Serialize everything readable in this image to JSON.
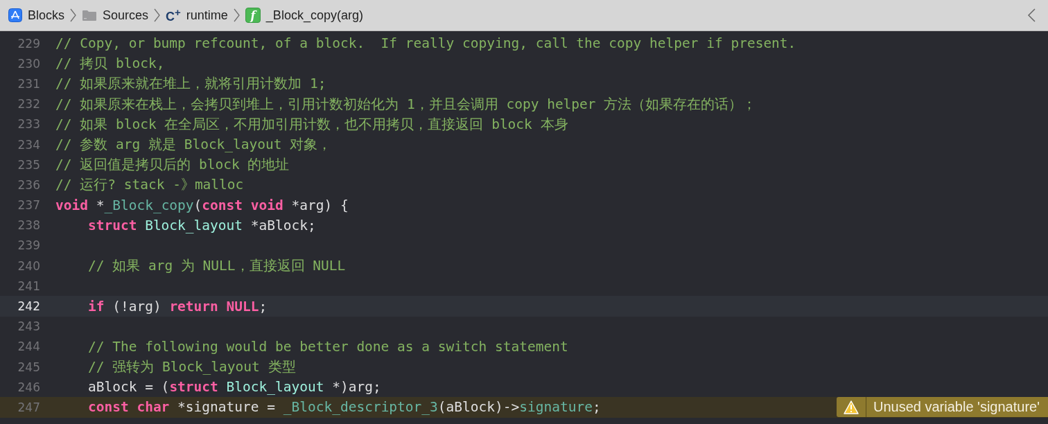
{
  "breadcrumb": [
    {
      "kind": "project",
      "label": "Blocks"
    },
    {
      "kind": "folder",
      "label": "Sources"
    },
    {
      "kind": "file",
      "icon_text": "C$^{+}$",
      "label": "runtime"
    },
    {
      "kind": "function",
      "icon_text": "f",
      "label": "_Block_copy(arg)"
    }
  ],
  "lines": [
    {
      "number": "229",
      "current": false,
      "tokens": [
        {
          "kind": "comment",
          "text": "// Copy, or bump refcount, of a block.  If really copying, call the copy helper if present."
        }
      ]
    },
    {
      "number": "230",
      "current": false,
      "tokens": [
        {
          "kind": "comment",
          "text": "// 拷贝 block,"
        }
      ]
    },
    {
      "number": "231",
      "current": false,
      "tokens": [
        {
          "kind": "comment",
          "text": "// 如果原来就在堆上，就将引用计数加 1;"
        }
      ]
    },
    {
      "number": "232",
      "current": false,
      "tokens": [
        {
          "kind": "comment",
          "text": "// 如果原来在栈上，会拷贝到堆上，引用计数初始化为 1，并且会调用 copy helper 方法（如果存在的话）；"
        }
      ]
    },
    {
      "number": "233",
      "current": false,
      "tokens": [
        {
          "kind": "comment",
          "text": "// 如果 block 在全局区，不用加引用计数，也不用拷贝，直接返回 block 本身"
        }
      ]
    },
    {
      "number": "234",
      "current": false,
      "tokens": [
        {
          "kind": "comment",
          "text": "// 参数 arg 就是 Block_layout 对象，"
        }
      ]
    },
    {
      "number": "235",
      "current": false,
      "tokens": [
        {
          "kind": "comment",
          "text": "// 返回值是拷贝后的 block 的地址"
        }
      ]
    },
    {
      "number": "236",
      "current": false,
      "tokens": [
        {
          "kind": "comment",
          "text": "// 运行? stack -》malloc"
        }
      ]
    },
    {
      "number": "237",
      "current": false,
      "tokens": [
        {
          "kind": "keyword",
          "text": "void"
        },
        {
          "kind": "plain",
          "text": " *"
        },
        {
          "kind": "function",
          "text": "_Block_copy"
        },
        {
          "kind": "plain",
          "text": "("
        },
        {
          "kind": "keyword",
          "text": "const void"
        },
        {
          "kind": "plain",
          "text": " *arg) {"
        }
      ]
    },
    {
      "number": "238",
      "current": false,
      "tokens": [
        {
          "kind": "keyword",
          "text": "    struct "
        },
        {
          "kind": "type",
          "text": "Block_layout"
        },
        {
          "kind": "plain",
          "text": " *aBlock;"
        }
      ]
    },
    {
      "number": "239",
      "current": false
    },
    {
      "number": "240",
      "current": false,
      "tokens": [
        {
          "kind": "comment",
          "text": "    // 如果 arg 为 NULL，直接返回 NULL"
        }
      ]
    },
    {
      "number": "241",
      "current": false
    },
    {
      "number": "242",
      "current": true,
      "tokens": [
        {
          "kind": "keyword",
          "text": "    if"
        },
        {
          "kind": "plain",
          "text": " (!arg) "
        },
        {
          "kind": "keyword",
          "text": "return NULL"
        },
        {
          "kind": "plain",
          "text": ";"
        }
      ]
    },
    {
      "number": "243",
      "current": false
    },
    {
      "number": "244",
      "current": false,
      "tokens": [
        {
          "kind": "comment",
          "text": "    // The following would be better done as a switch statement"
        }
      ]
    },
    {
      "number": "245",
      "current": false,
      "tokens": [
        {
          "kind": "comment",
          "text": "    // 强转为 Block_layout 类型"
        }
      ]
    },
    {
      "number": "246",
      "current": false,
      "tokens": [
        {
          "kind": "plain",
          "text": "    aBlock = ("
        },
        {
          "kind": "keyword",
          "text": "struct "
        },
        {
          "kind": "type",
          "text": "Block_layout"
        },
        {
          "kind": "plain",
          "text": " *)arg;"
        }
      ]
    },
    {
      "number": "247",
      "current": false,
      "warning": "Unused variable 'signature'",
      "tokens": [
        {
          "kind": "keyword",
          "text": "    const char"
        },
        {
          "kind": "plain",
          "text": " *signature = "
        },
        {
          "kind": "function",
          "text": "_Block_descriptor_3"
        },
        {
          "kind": "plain",
          "text": "(aBlock)->"
        },
        {
          "kind": "function",
          "text": "signature"
        },
        {
          "kind": "plain",
          "text": ";"
        }
      ]
    }
  ]
}
